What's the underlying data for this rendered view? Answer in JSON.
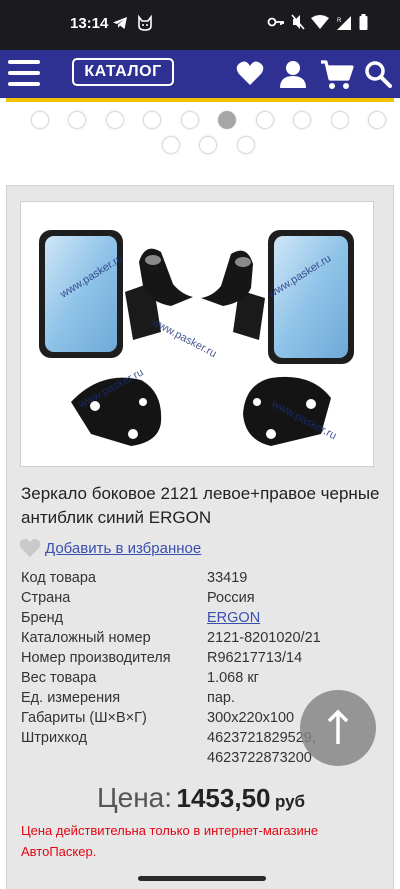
{
  "status_bar": {
    "time": "13:14",
    "left_icons": [
      "telegram-icon",
      "cat-icon"
    ],
    "right_icons": [
      "key-icon",
      "mute-icon",
      "wifi-icon",
      "signal-icon",
      "battery-icon"
    ]
  },
  "nav": {
    "catalog_label": "КАТАЛОГ",
    "icons": [
      "menu-icon",
      "heart-icon",
      "user-icon",
      "cart-icon",
      "search-icon"
    ]
  },
  "gallery": {
    "dot_count": 13,
    "active_index": 5
  },
  "product": {
    "title": "Зеркало боковое 2121 левое+правое черные антиблик синий ERGON",
    "watermark": "www.pasker.ru",
    "favorite_label": "Добавить в избранное",
    "specs": [
      {
        "label": "Код товара",
        "value": "33419"
      },
      {
        "label": "Страна",
        "value": "Россия"
      },
      {
        "label": "Бренд",
        "value": "ERGON"
      },
      {
        "label": "Каталожный номер",
        "value": "2121-8201020/21"
      },
      {
        "label": "Номер производителя",
        "value": "R96217713/14"
      },
      {
        "label": "Вес товара",
        "value": "1.068 кг"
      },
      {
        "label": "Ед. измерения",
        "value": "пар."
      },
      {
        "label": "Габариты (Ш×В×Г)",
        "value": "300х220х100"
      },
      {
        "label": "Штрихкод",
        "value": "4623721829529,",
        "value2": "4623722873200"
      }
    ],
    "price_label": "Цена:",
    "price_value": "1453,50",
    "price_currency": "руб",
    "price_note": "Цена действительна только в интернет-магазине АвтоПаскер."
  },
  "colors": {
    "nav_bg": "#2e3192",
    "accent_yellow": "#f2c200",
    "link": "#3a4fb0",
    "note_red": "#e30613"
  }
}
